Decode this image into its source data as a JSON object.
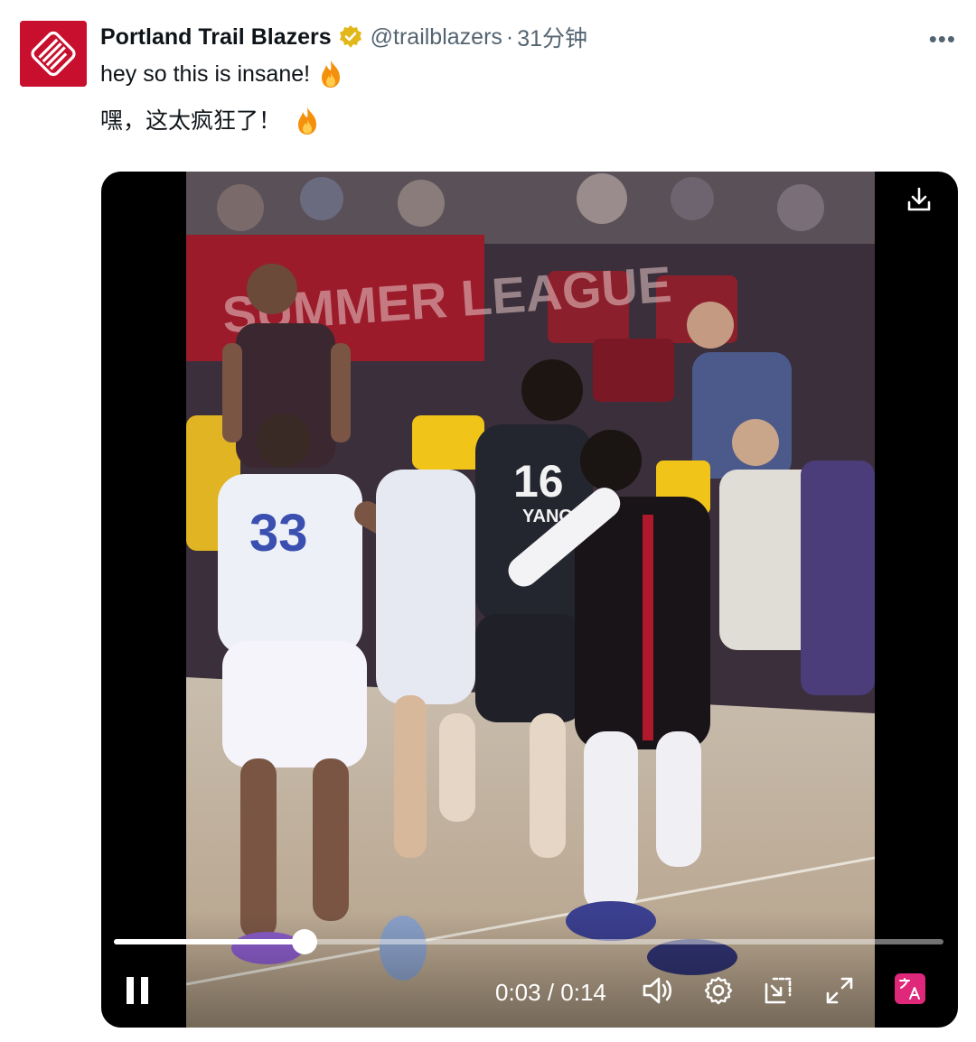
{
  "tweet": {
    "author_name": "Portland Trail Blazers",
    "handle": "@trailblazers",
    "separator": "·",
    "time": "31分钟",
    "more_label": "•••",
    "text_original": "hey so this is insane!",
    "text_translated": "嘿，这太疯狂了！"
  },
  "icons": {
    "avatar": "trail-blazers-logo",
    "verified": "verified-badge-icon",
    "emoji": "fire-emoji"
  },
  "video": {
    "jersey_number_center": "16",
    "jersey_name_center": "YANG",
    "jersey_number_left": "33",
    "banner_text": "SUMMER LEAGUE",
    "current_time": "0:03",
    "duration": "0:14",
    "timecode": "0:03 / 0:14",
    "progress": 0.23
  },
  "colors": {
    "brand_red": "#c8102e",
    "verified_gold": "#e2b719",
    "secondary_text": "#536471"
  }
}
